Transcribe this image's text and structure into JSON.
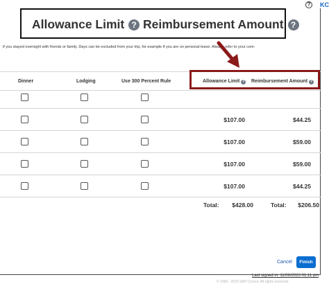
{
  "header": {
    "user_initials": "KC"
  },
  "modal": {
    "description": "if you stayed overnight with friends or family. Days can be excluded from your trip, for example if you are on personal leave. Always refer to your com-",
    "columns": {
      "dinner": "Dinner",
      "lodging": "Lodging",
      "use300": "Use 300 Percent Rule",
      "allowance_limit": "Allowance Limit",
      "reimbursement_amount": "Reimbursement Amount"
    },
    "rows": [
      {
        "allowance": "",
        "reimbursement": ""
      },
      {
        "allowance": "$107.00",
        "reimbursement": "$44.25"
      },
      {
        "allowance": "$107.00",
        "reimbursement": "$59.00"
      },
      {
        "allowance": "$107.00",
        "reimbursement": "$59.00"
      },
      {
        "allowance": "$107.00",
        "reimbursement": "$44.25"
      }
    ],
    "totals": {
      "allowance_label": "Total:",
      "allowance_value": "$428.00",
      "reimbursement_label": "Total:",
      "reimbursement_value": "$206.50"
    },
    "buttons": {
      "cancel": "Cancel",
      "finish": "Finish"
    }
  },
  "footer": {
    "last_signed_in": "Last signed in: 11/08/2023 01:11 pm",
    "copyright": "© 1993 - 2023 SAP Concur. All rights reserved."
  },
  "callout": {
    "allowance_limit": "Allowance Limit",
    "reimbursement_amount": "Reimbursement Amount"
  },
  "colors": {
    "highlight": "#8b1a1a",
    "primary_button": "#0a6ed1",
    "link": "#1a56a8"
  },
  "icons": {
    "help": "question-circle-icon",
    "annotation": "red-arrow-icon"
  }
}
